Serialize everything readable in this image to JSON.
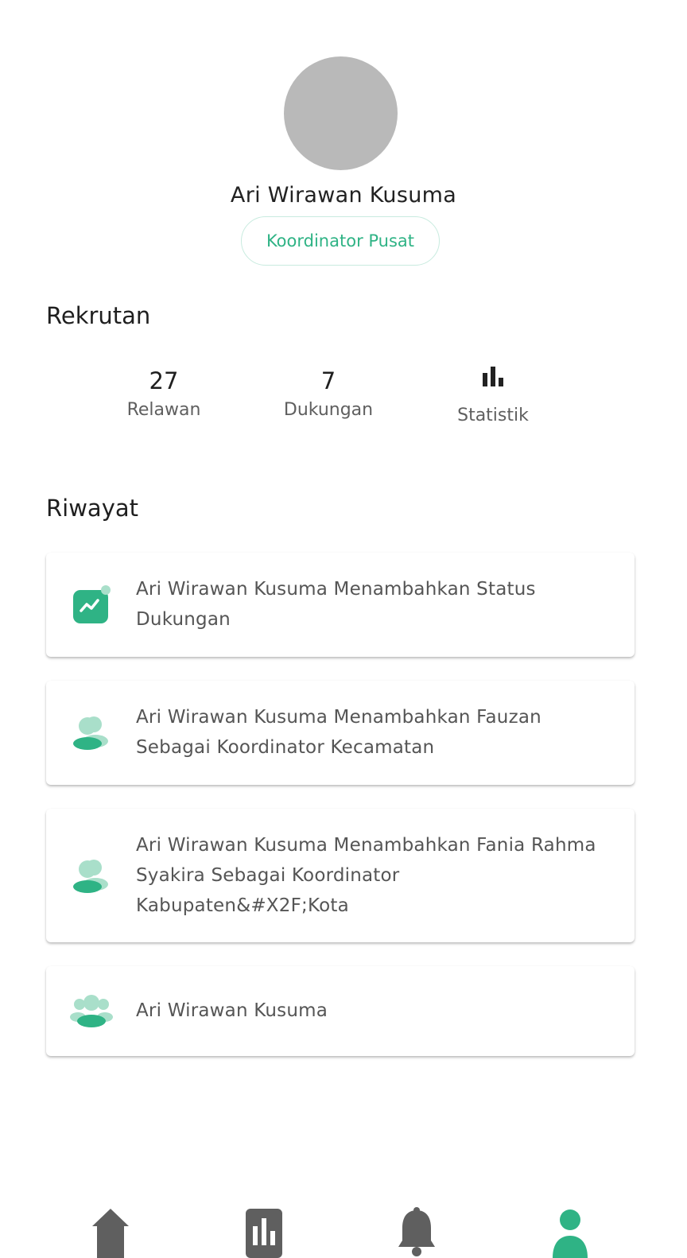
{
  "profile": {
    "name": "Ari Wirawan Kusuma",
    "role": "Koordinator Pusat"
  },
  "rekrutan": {
    "title": "Rekrutan",
    "stats": [
      {
        "value": "27",
        "label": "Relawan"
      },
      {
        "value": "7",
        "label": "Dukungan"
      }
    ],
    "statistik_label": "Statistik",
    "statistik_icon": "bar-chart-icon"
  },
  "riwayat": {
    "title": "Riwayat",
    "items": [
      {
        "icon": "trending-status-icon",
        "text": "Ari Wirawan Kusuma Menambahkan Status Dukungan"
      },
      {
        "icon": "users-icon",
        "text": "Ari Wirawan Kusuma Menambahkan Fauzan Sebagai Koordinator Kecamatan"
      },
      {
        "icon": "users-icon",
        "text": "Ari Wirawan Kusuma Menambahkan Fania Rahma Syakira Sebagai Koordinator Kabupaten&#X2F;Kota"
      },
      {
        "icon": "group-icon",
        "text": "Ari Wirawan Kusuma"
      }
    ]
  },
  "bottom_nav": [
    {
      "icon": "home-icon",
      "active": false
    },
    {
      "icon": "chart-icon",
      "active": false
    },
    {
      "icon": "bell-icon",
      "active": false
    },
    {
      "icon": "profile-icon",
      "active": true
    }
  ],
  "colors": {
    "accent": "#2fb385",
    "accent_light": "#a9dfca",
    "nav_inactive": "#5f5f5f",
    "avatar_placeholder": "#b9b9b9"
  }
}
